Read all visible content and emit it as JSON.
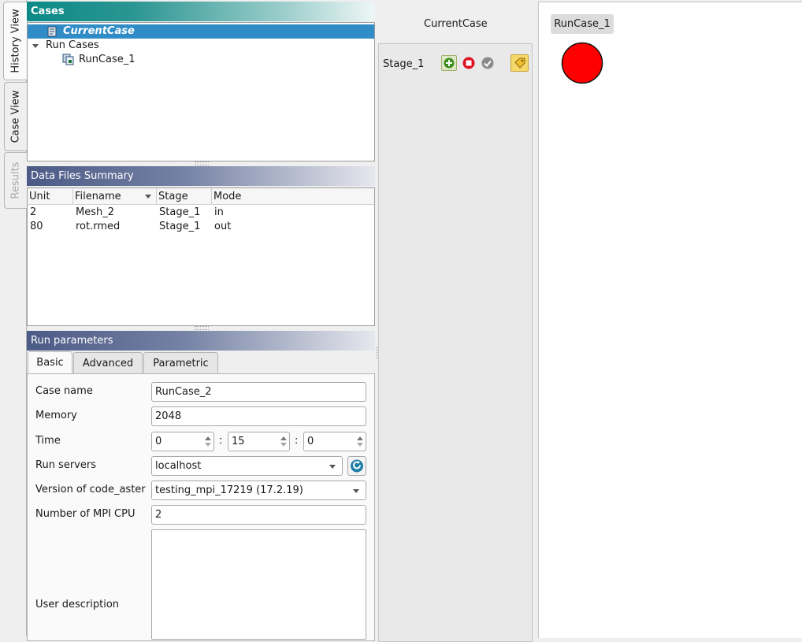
{
  "side_tabs": {
    "history": "History View",
    "case": "Case View",
    "results": "Results"
  },
  "cases_panel": {
    "title": "Cases",
    "current_case": "CurrentCase",
    "run_cases_label": "Run Cases",
    "run_cases": [
      "RunCase_1"
    ]
  },
  "data_files": {
    "title": "Data Files Summary",
    "columns": [
      "Unit",
      "Filename",
      "Stage",
      "Mode"
    ],
    "rows": [
      {
        "unit": "2",
        "filename": "Mesh_2",
        "stage": "Stage_1",
        "mode": "in"
      },
      {
        "unit": "80",
        "filename": "rot.rmed",
        "stage": "Stage_1",
        "mode": "out"
      }
    ]
  },
  "run_params": {
    "title": "Run parameters",
    "tabs": [
      "Basic",
      "Advanced",
      "Parametric"
    ],
    "case_name_label": "Case name",
    "case_name": "RunCase_2",
    "memory_label": "Memory",
    "memory": "2048",
    "time_label": "Time",
    "time_h": "0",
    "time_m": "15",
    "time_s": "0",
    "time_sep": ":",
    "servers_label": "Run servers",
    "server": "localhost",
    "version_label": "Version of code_aster",
    "version": "testing_mpi_17219 (17.2.19)",
    "mpi_label": "Number of MPI CPU",
    "mpi": "2",
    "desc_label": "User description",
    "desc": ""
  },
  "case_view": {
    "title": "CurrentCase",
    "stage": "Stage_1"
  },
  "dashboard": {
    "run_case": "RunCase_1",
    "status_color": "#ff0000"
  },
  "colors": {
    "selection": "#308cc6",
    "teal": "#0c8a87",
    "slate": "#4b5a86"
  }
}
